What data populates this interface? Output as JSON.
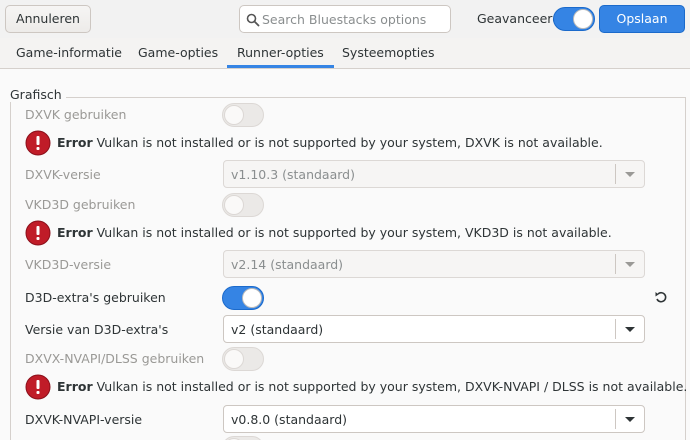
{
  "header": {
    "cancel_label": "Annuleren",
    "search_placeholder": "Search Bluestacks options",
    "advanced_label": "Geavanceerd",
    "advanced_on": true,
    "save_label": "Opslaan"
  },
  "tabs": [
    {
      "label": "Game-informatie",
      "active": false
    },
    {
      "label": "Game-opties",
      "active": false
    },
    {
      "label": "Runner-opties",
      "active": true
    },
    {
      "label": "Systeemopties",
      "active": false
    }
  ],
  "section": {
    "title": "Grafisch",
    "rows": {
      "dxvk_use": {
        "label": "DXVK gebruiken",
        "state": "disabled-off"
      },
      "dxvk_error": {
        "title": "Error",
        "message": "Vulkan is not installed or is not supported by your system, DXVK is not available."
      },
      "dxvk_version": {
        "label": "DXVK-versie",
        "value": "v1.10.3 (standaard)",
        "disabled": true
      },
      "vkd3d_use": {
        "label": "VKD3D gebruiken",
        "state": "disabled-off"
      },
      "vkd3d_error": {
        "title": "Error",
        "message": "Vulkan is not installed or is not supported by your system, VKD3D is not available."
      },
      "vkd3d_version": {
        "label": "VKD3D-versie",
        "value": "v2.14 (standaard)",
        "disabled": true
      },
      "d3d_extras_use": {
        "label": "D3D-extra's gebruiken",
        "state": "on"
      },
      "d3d_extras_version": {
        "label": "Versie van D3D-extra's",
        "value": "v2 (standaard)",
        "disabled": false
      },
      "nvapi_use": {
        "label": "DXVX-NVAPI/DLSS gebruiken",
        "state": "disabled-off"
      },
      "nvapi_error": {
        "title": "Error",
        "message": "Vulkan is not installed or is not supported by your system, DXVK-NVAPI / DLSS is not available."
      },
      "nvapi_version": {
        "label": "DXVK-NVAPI-versie",
        "value": "v0.8.0 (standaard)",
        "disabled": false
      }
    }
  },
  "colors": {
    "accent": "#3584e4",
    "error": "#c01c28"
  }
}
